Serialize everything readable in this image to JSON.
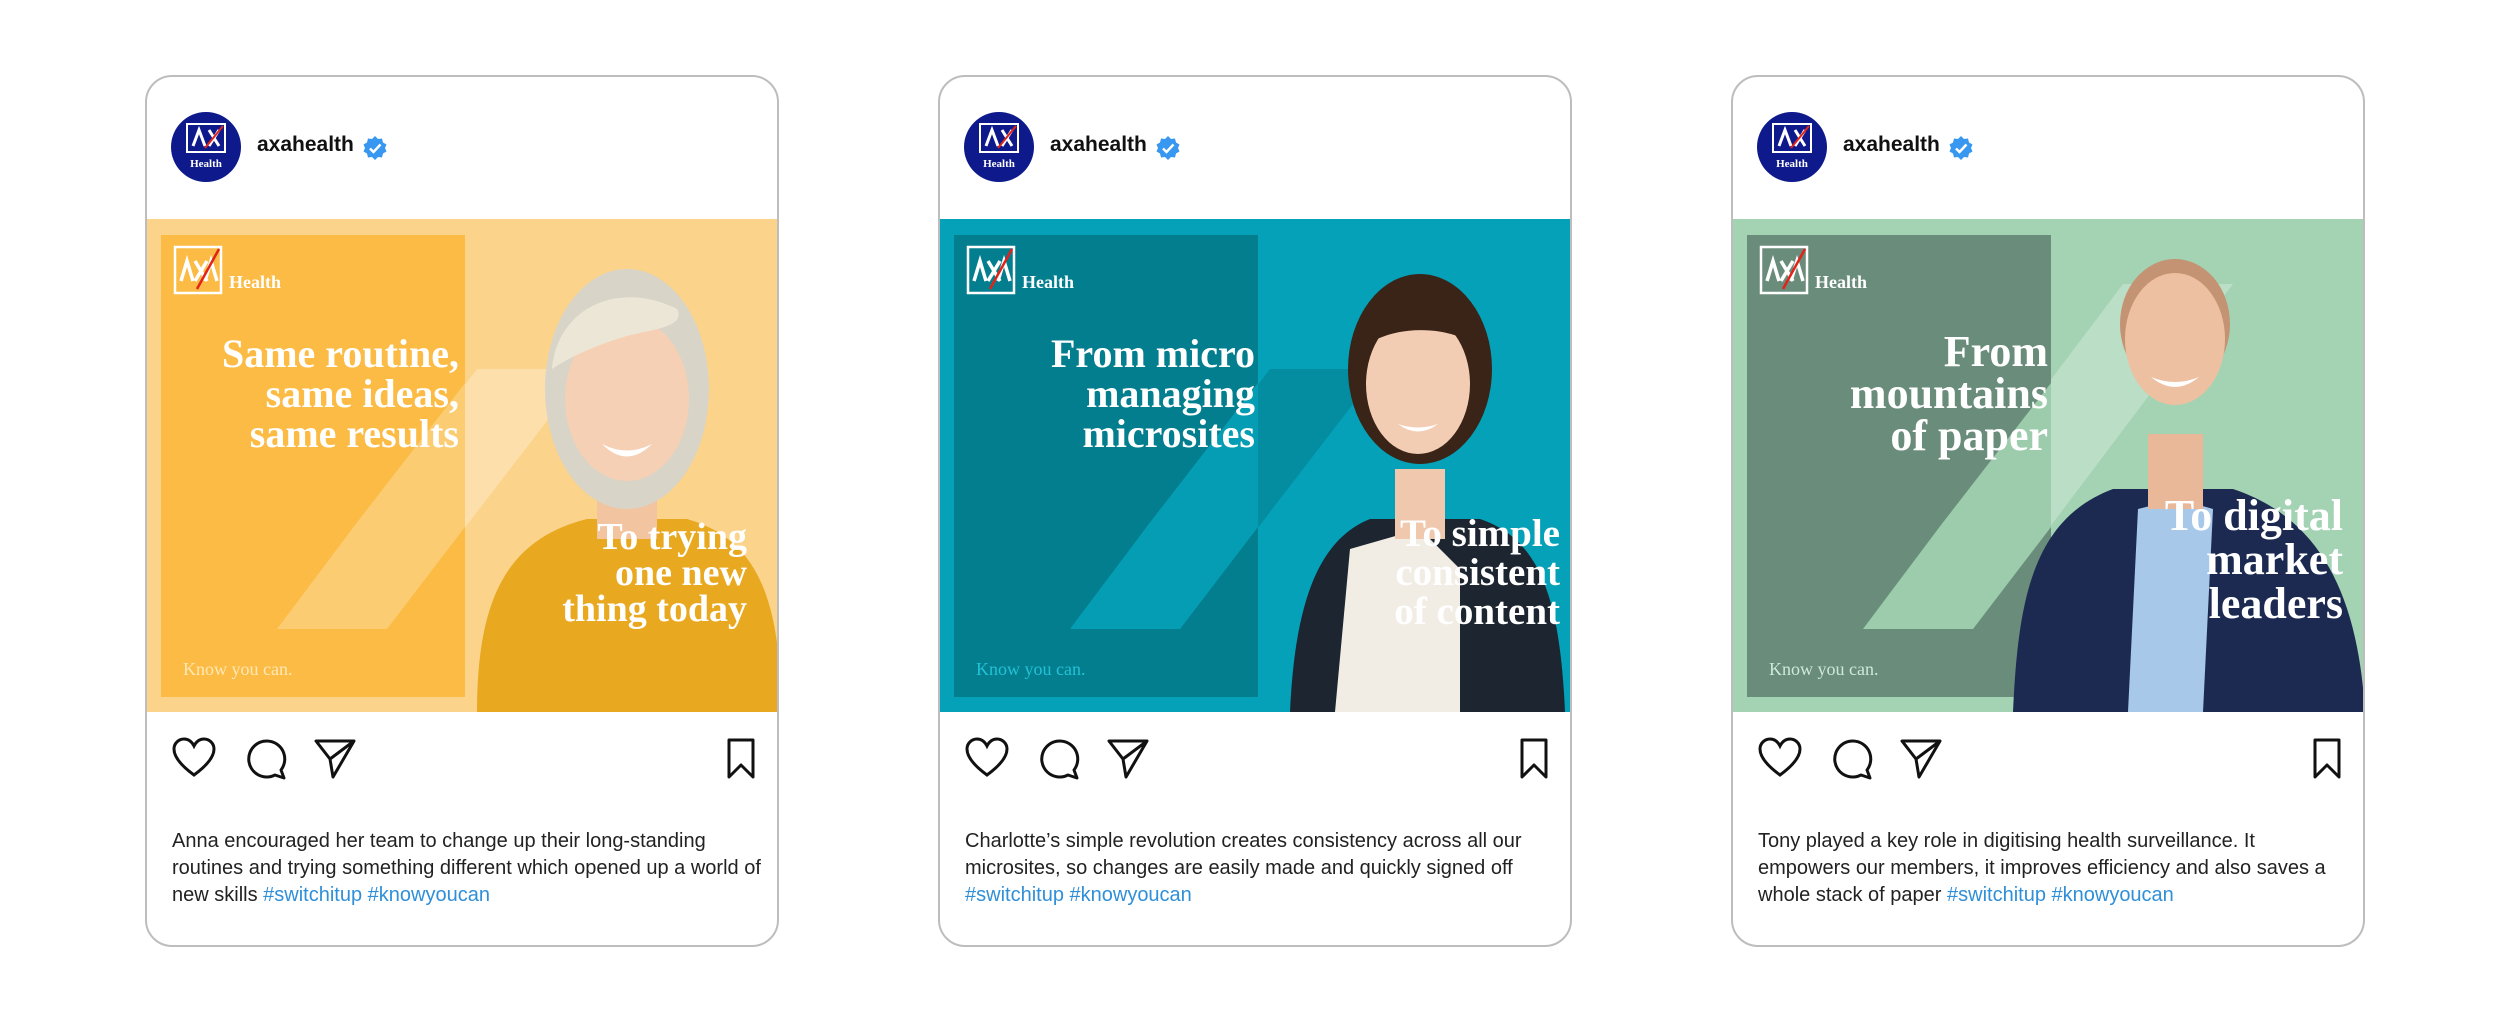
{
  "posts": [
    {
      "account": "axahealth",
      "avatar_text": "Health",
      "logo_text": "Health",
      "headline_top": "Same routine,\nsame ideas,\nsame results",
      "headline_bottom": "To trying\none new\nthing today",
      "tagline": "Know you can.",
      "caption_text": "Anna encouraged her team to change up their long-standing routines and trying something different which opened up a world of new skills",
      "hashtags": [
        "#switchitup",
        "#knowyoucan"
      ],
      "theme": {
        "bg": "#fbd38a",
        "panel": "#fbbb44"
      }
    },
    {
      "account": "axahealth",
      "avatar_text": "Health",
      "logo_text": "Health",
      "headline_top": "From micro\nmanaging\nmicrosites",
      "headline_bottom": "To simple\nconsistent\nof content",
      "tagline": "Know you can.",
      "caption_text": "Charlotte’s simple revolution creates consistency across all our microsites, so changes are easily made and quickly signed off",
      "hashtags": [
        "#switchitup",
        "#knowyoucan"
      ],
      "theme": {
        "bg": "#05a1b8",
        "panel": "#037e8e"
      }
    },
    {
      "account": "axahealth",
      "avatar_text": "Health",
      "logo_text": "Health",
      "headline_top": "From\nmountains\nof paper",
      "headline_bottom": "To digital\nmarket\nleaders",
      "tagline": "Know you can.",
      "caption_text": "Tony played a key role in digitising health surveillance. It empowers our members, it improves efficiency and also saves a whole stack of paper",
      "hashtags": [
        "#switchitup",
        "#knowyoucan"
      ],
      "theme": {
        "bg": "#a3d3b3",
        "panel": "#6a8c7b"
      }
    }
  ],
  "icons": [
    "verified-badge-icon",
    "heart-icon",
    "comment-icon",
    "share-icon",
    "bookmark-icon",
    "axa-logo-icon"
  ]
}
